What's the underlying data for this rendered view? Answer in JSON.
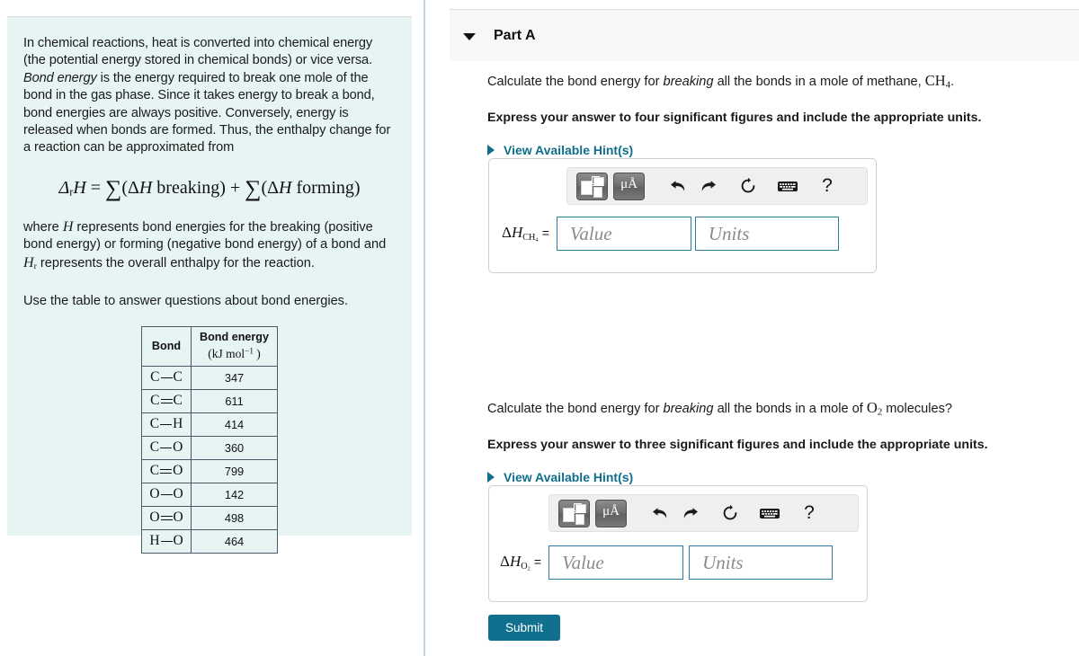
{
  "colors": {
    "left_panel_bg": "#e6f5f3",
    "accent_teal": "#12708f",
    "hint_link": "#0f6e8c",
    "field_border": "#2b7ca3",
    "header_bg": "#f7f7f7",
    "divider": "#c3d3df"
  },
  "left_panel": {
    "intro_paragraph_parts": {
      "p1": "In chemical reactions, heat is converted into chemical energy (the potential energy stored in chemical bonds) or vice versa. ",
      "em1": "Bond energy",
      "p2": " is the energy required to break one mole of the bond in the gas phase. Since it takes energy to break a bond, bond energies are always positive. Conversely, energy is released when bonds are formed. Thus, the enthalpy change for a reaction can be approximated from"
    },
    "formula": {
      "lhs_symbol": "Δ",
      "lhs_sub": "r",
      "lhs_var": "H",
      "equals": "=",
      "sum_glyph": "∑",
      "term1": "(ΔH breaking)",
      "plus": "+",
      "term2": "(ΔH forming)",
      "full_text": "Δ_r H = ∑(ΔH breaking) + ∑(ΔH forming)"
    },
    "where_text": {
      "p1": "where ",
      "var1": "H",
      "p2": " represents bond energies for the breaking (positive bond energy) or forming (negative bond energy) of a bond and ",
      "var2": "H",
      "var2_sub": "r",
      "p3": " represents the overall enthalpy for the reaction."
    },
    "use_table_text": "Use the table to answer questions about bond energies.",
    "table": {
      "headers": {
        "bond": "Bond",
        "energy_line1": "Bond energy",
        "energy_unit_prefix": "(kJ mol",
        "energy_unit_sup": "−1",
        "energy_unit_suffix": " )"
      },
      "rows": [
        {
          "atom_left": "C",
          "bond_type": "single",
          "atom_right": "C",
          "label": "C–C",
          "value": "347"
        },
        {
          "atom_left": "C",
          "bond_type": "double",
          "atom_right": "C",
          "label": "C=C",
          "value": "611"
        },
        {
          "atom_left": "C",
          "bond_type": "single",
          "atom_right": "H",
          "label": "C–H",
          "value": "414"
        },
        {
          "atom_left": "C",
          "bond_type": "single",
          "atom_right": "O",
          "label": "C–O",
          "value": "360"
        },
        {
          "atom_left": "C",
          "bond_type": "double",
          "atom_right": "O",
          "label": "C=O",
          "value": "799"
        },
        {
          "atom_left": "O",
          "bond_type": "single",
          "atom_right": "O",
          "label": "O–O",
          "value": "142"
        },
        {
          "atom_left": "O",
          "bond_type": "double",
          "atom_right": "O",
          "label": "O=O",
          "value": "498"
        },
        {
          "atom_left": "H",
          "bond_type": "single",
          "atom_right": "O",
          "label": "H–O",
          "value": "464"
        }
      ]
    }
  },
  "right_panel": {
    "part_header": {
      "title": "Part A",
      "caret": "caret-down-icon"
    },
    "questions": [
      {
        "prompt_p1": "Calculate the bond energy for ",
        "prompt_em": "breaking",
        "prompt_p2": " all the bonds in a mole of methane, ",
        "formula_main": "CH",
        "formula_sub": "4",
        "prompt_p3": ".",
        "instruction": "Express your answer to four significant figures and include the appropriate units.",
        "hint_label": "View Available Hint(s)",
        "answer": {
          "label_delta": "Δ",
          "label_var": "H",
          "label_sub": "CH",
          "label_sub2": "4",
          "equals": "=",
          "value_placeholder": "Value",
          "units_placeholder": "Units",
          "value_current": "",
          "units_current": ""
        }
      },
      {
        "prompt_p1": "Calculate the bond energy for ",
        "prompt_em": "breaking",
        "prompt_p2": " all the bonds in a mole of ",
        "formula_main": "O",
        "formula_sub": "2",
        "prompt_p3": " molecules?",
        "instruction": "Express your answer to three significant figures and include the appropriate units.",
        "hint_label": "View Available Hint(s)",
        "answer": {
          "label_delta": "Δ",
          "label_var": "H",
          "label_sub": "O",
          "label_sub2": "2",
          "equals": "=",
          "value_placeholder": "Value",
          "units_placeholder": "Units",
          "value_current": "",
          "units_current": ""
        }
      }
    ],
    "toolbar": {
      "template_button": "math-template-icon",
      "units_button_label": "μÅ",
      "undo": "undo-arrow-icon",
      "redo": "redo-arrow-icon",
      "reset": "reset-circle-icon",
      "keyboard": "keyboard-icon",
      "help": "?"
    },
    "submit_label": "Submit"
  }
}
